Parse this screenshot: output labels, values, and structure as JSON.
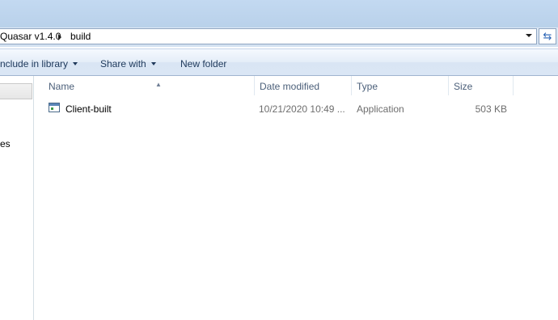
{
  "address": {
    "crumbs": [
      "Quasar v1.4.0",
      "build"
    ],
    "refresh_icon": "refresh-icon"
  },
  "toolbar": {
    "include_label": "nclude in library",
    "share_label": "Share with",
    "new_folder_label": "New folder"
  },
  "nav": {
    "partial_label": "es"
  },
  "columns": {
    "name": "Name",
    "date": "Date modified",
    "type": "Type",
    "size": "Size"
  },
  "files": [
    {
      "name": "Client-built",
      "date": "10/21/2020 10:49 ...",
      "type": "Application",
      "size": "503 KB",
      "icon": "application-icon"
    }
  ]
}
